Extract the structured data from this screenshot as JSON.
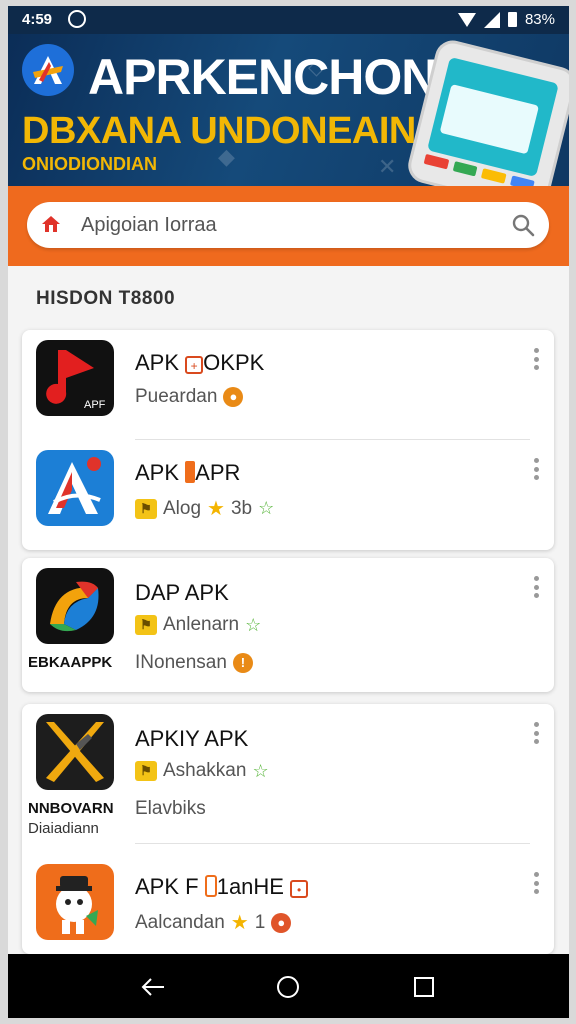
{
  "status_bar": {
    "time": "4:59",
    "battery": "83%"
  },
  "banner": {
    "title": "APRKENCHONS",
    "subtitle": "DBXANA UNDONEAIN",
    "small_text": "ONIODIONDIAN"
  },
  "search": {
    "placeholder": "Apigoian Iorraa"
  },
  "section": {
    "title": "HISDON T8800"
  },
  "apps": [
    {
      "name": "APK",
      "name_suffix": "OKPK",
      "meta": "Pueardan",
      "icon_label": "APF",
      "colors": {
        "bg": "#111111",
        "accent": "#e21f1f"
      }
    },
    {
      "name": "APK",
      "name_suffix": "APR",
      "meta": "Alog",
      "rating": "3b",
      "colors": {
        "bg": "#1c7fd6",
        "accent": "#e0332a"
      }
    },
    {
      "name": "DAP APK",
      "meta": "Anlenarn",
      "meta2": "INonensan",
      "below_label": "EBKAAPPK",
      "colors": {
        "bg": "#111111",
        "accent": "#f2a20c"
      }
    },
    {
      "name": "APKIY APK",
      "meta": "Ashakkan",
      "meta2": "Elavbiks",
      "below_label": "NNBOVARN",
      "below_label2": "Diaiadiann",
      "colors": {
        "bg": "#1d1d1d",
        "accent": "#f0a90f"
      }
    },
    {
      "name": "APK F",
      "name_suffix": "1anHE",
      "meta": "Aalcandan",
      "rating": "1",
      "colors": {
        "bg": "#ef6d1b",
        "accent": "#ffffff"
      }
    }
  ],
  "nav": {
    "back": "back-icon",
    "home": "home-icon",
    "recents": "recents-icon"
  }
}
